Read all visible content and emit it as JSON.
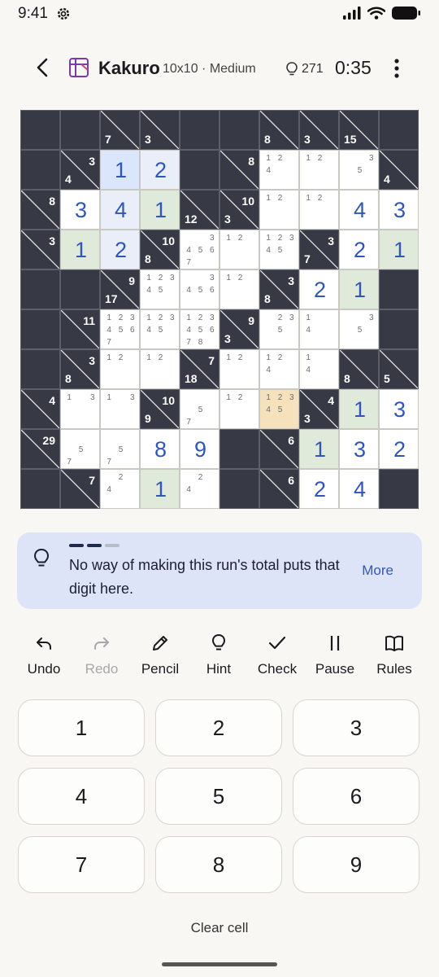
{
  "status": {
    "time": "9:41"
  },
  "header": {
    "title": "Kakuro",
    "subtitle": "10x10 · Medium",
    "hints": "271",
    "timer": "0:35"
  },
  "board": {
    "rows": 10,
    "cols": 10,
    "cells": [
      [
        {
          "t": "b"
        },
        {
          "t": "b"
        },
        {
          "t": "c",
          "d": "7"
        },
        {
          "t": "c",
          "d": "3"
        },
        {
          "t": "b"
        },
        {
          "t": "b"
        },
        {
          "t": "c",
          "d": "8"
        },
        {
          "t": "c",
          "d": "3"
        },
        {
          "t": "c",
          "d": "15"
        },
        {
          "t": "b"
        }
      ],
      [
        {
          "t": "b"
        },
        {
          "t": "c",
          "r": "3",
          "d": "4"
        },
        {
          "t": "w",
          "v": "1",
          "bg": "sel"
        },
        {
          "t": "w",
          "v": "2",
          "bg": "rel"
        },
        {
          "t": "b"
        },
        {
          "t": "c",
          "r": "8"
        },
        {
          "t": "w",
          "n": [
            "1",
            "2",
            "",
            "4"
          ]
        },
        {
          "t": "w",
          "n": [
            "1",
            "2"
          ]
        },
        {
          "t": "w",
          "n": [
            "",
            "",
            "3",
            "",
            "5"
          ]
        },
        {
          "t": "c",
          "d": "4"
        }
      ],
      [
        {
          "t": "c",
          "r": "8"
        },
        {
          "t": "w",
          "v": "3"
        },
        {
          "t": "w",
          "v": "4",
          "bg": "rel"
        },
        {
          "t": "w",
          "v": "1",
          "bg": "green"
        },
        {
          "t": "c",
          "d": "12"
        },
        {
          "t": "c",
          "r": "10",
          "d": "3"
        },
        {
          "t": "w",
          "n": [
            "1",
            "2"
          ]
        },
        {
          "t": "w",
          "n": [
            "1",
            "2"
          ]
        },
        {
          "t": "w",
          "v": "4"
        },
        {
          "t": "w",
          "v": "3"
        }
      ],
      [
        {
          "t": "c",
          "r": "3"
        },
        {
          "t": "w",
          "v": "1",
          "bg": "green"
        },
        {
          "t": "w",
          "v": "2",
          "bg": "rel"
        },
        {
          "t": "c",
          "r": "10",
          "d": "8"
        },
        {
          "t": "w",
          "n": [
            "",
            "",
            "3",
            "4",
            "5",
            "6",
            "7"
          ]
        },
        {
          "t": "w",
          "n": [
            "1",
            "2"
          ]
        },
        {
          "t": "w",
          "n": [
            "1",
            "2",
            "3",
            "4",
            "5"
          ]
        },
        {
          "t": "c",
          "r": "3",
          "d": "7"
        },
        {
          "t": "w",
          "v": "2"
        },
        {
          "t": "w",
          "v": "1",
          "bg": "green"
        }
      ],
      [
        {
          "t": "b"
        },
        {
          "t": "b"
        },
        {
          "t": "c",
          "r": "9",
          "d": "17"
        },
        {
          "t": "w",
          "n": [
            "1",
            "2",
            "3",
            "4",
            "5"
          ]
        },
        {
          "t": "w",
          "n": [
            "",
            "",
            "3",
            "4",
            "5",
            "6"
          ]
        },
        {
          "t": "w",
          "n": [
            "1",
            "2"
          ]
        },
        {
          "t": "c",
          "r": "3",
          "d": "8"
        },
        {
          "t": "w",
          "v": "2"
        },
        {
          "t": "w",
          "v": "1",
          "bg": "green"
        },
        {
          "t": "b"
        }
      ],
      [
        {
          "t": "b"
        },
        {
          "t": "c",
          "r": "11"
        },
        {
          "t": "w",
          "n": [
            "1",
            "2",
            "3",
            "4",
            "5",
            "6",
            "7"
          ]
        },
        {
          "t": "w",
          "n": [
            "1",
            "2",
            "3",
            "4",
            "5"
          ]
        },
        {
          "t": "w",
          "n": [
            "1",
            "2",
            "3",
            "4",
            "5",
            "6",
            "7",
            "8"
          ]
        },
        {
          "t": "c",
          "r": "9",
          "d": "3"
        },
        {
          "t": "w",
          "n": [
            "",
            "2",
            "3",
            "",
            "5"
          ]
        },
        {
          "t": "w",
          "n": [
            "1",
            "",
            "",
            "4"
          ]
        },
        {
          "t": "w",
          "n": [
            "",
            "",
            "3",
            "",
            "5"
          ]
        },
        {
          "t": "b"
        }
      ],
      [
        {
          "t": "b"
        },
        {
          "t": "c",
          "r": "3",
          "d": "8"
        },
        {
          "t": "w",
          "n": [
            "1",
            "2"
          ]
        },
        {
          "t": "w",
          "n": [
            "1",
            "2"
          ]
        },
        {
          "t": "c",
          "r": "7",
          "d": "18"
        },
        {
          "t": "w",
          "n": [
            "1",
            "2"
          ]
        },
        {
          "t": "w",
          "n": [
            "1",
            "2",
            "",
            "4"
          ]
        },
        {
          "t": "w",
          "n": [
            "1",
            "",
            "",
            "4"
          ]
        },
        {
          "t": "c",
          "d": "8"
        },
        {
          "t": "c",
          "d": "5"
        }
      ],
      [
        {
          "t": "c",
          "r": "4"
        },
        {
          "t": "w",
          "n": [
            "1",
            "",
            "3"
          ]
        },
        {
          "t": "w",
          "n": [
            "1",
            "",
            "3"
          ]
        },
        {
          "t": "c",
          "r": "10",
          "d": "9"
        },
        {
          "t": "w",
          "n": [
            "",
            "",
            "",
            "",
            "5",
            "",
            "7"
          ]
        },
        {
          "t": "w",
          "n": [
            "1",
            "2"
          ]
        },
        {
          "t": "w",
          "n": [
            "1",
            "2",
            "3",
            "4",
            "5"
          ],
          "bg": "focus"
        },
        {
          "t": "c",
          "r": "4",
          "d": "3"
        },
        {
          "t": "w",
          "v": "1",
          "bg": "green"
        },
        {
          "t": "w",
          "v": "3"
        }
      ],
      [
        {
          "t": "c",
          "r": "29"
        },
        {
          "t": "w",
          "n": [
            "",
            "",
            "",
            "",
            "5",
            "",
            "7"
          ]
        },
        {
          "t": "w",
          "n": [
            "",
            "",
            "",
            "",
            "5",
            "",
            "7"
          ]
        },
        {
          "t": "w",
          "v": "8"
        },
        {
          "t": "w",
          "v": "9"
        },
        {
          "t": "b"
        },
        {
          "t": "c",
          "r": "6"
        },
        {
          "t": "w",
          "v": "1",
          "bg": "green"
        },
        {
          "t": "w",
          "v": "3"
        },
        {
          "t": "w",
          "v": "2"
        }
      ],
      [
        {
          "t": "b"
        },
        {
          "t": "c",
          "r": "7"
        },
        {
          "t": "w",
          "n": [
            "",
            "2",
            "",
            "4"
          ]
        },
        {
          "t": "w",
          "v": "1",
          "bg": "green"
        },
        {
          "t": "w",
          "n": [
            "",
            "2",
            "",
            "4"
          ]
        },
        {
          "t": "b"
        },
        {
          "t": "c",
          "r": "6"
        },
        {
          "t": "w",
          "v": "2"
        },
        {
          "t": "w",
          "v": "4"
        },
        {
          "t": "b"
        }
      ]
    ]
  },
  "hint": {
    "text": "No way of making this run's total puts that digit here.",
    "more": "More",
    "steps": 3,
    "current": 2
  },
  "toolbar": [
    {
      "label": "Undo",
      "icon": "undo-icon",
      "enabled": true
    },
    {
      "label": "Redo",
      "icon": "redo-icon",
      "enabled": false
    },
    {
      "label": "Pencil",
      "icon": "pencil-icon",
      "enabled": true
    },
    {
      "label": "Hint",
      "icon": "lightbulb-icon",
      "enabled": true
    },
    {
      "label": "Check",
      "icon": "check-icon",
      "enabled": true
    },
    {
      "label": "Pause",
      "icon": "pause-icon",
      "enabled": true
    },
    {
      "label": "Rules",
      "icon": "book-icon",
      "enabled": true
    }
  ],
  "keypad": [
    "1",
    "2",
    "3",
    "4",
    "5",
    "6",
    "7",
    "8",
    "9"
  ],
  "clear_label": "Clear cell",
  "colors": {
    "selected": "#dbe5fb",
    "related": "#e9eef9",
    "green": "#dfeadb",
    "focus": "#f6e1bd",
    "digit": "#2f56b8"
  }
}
